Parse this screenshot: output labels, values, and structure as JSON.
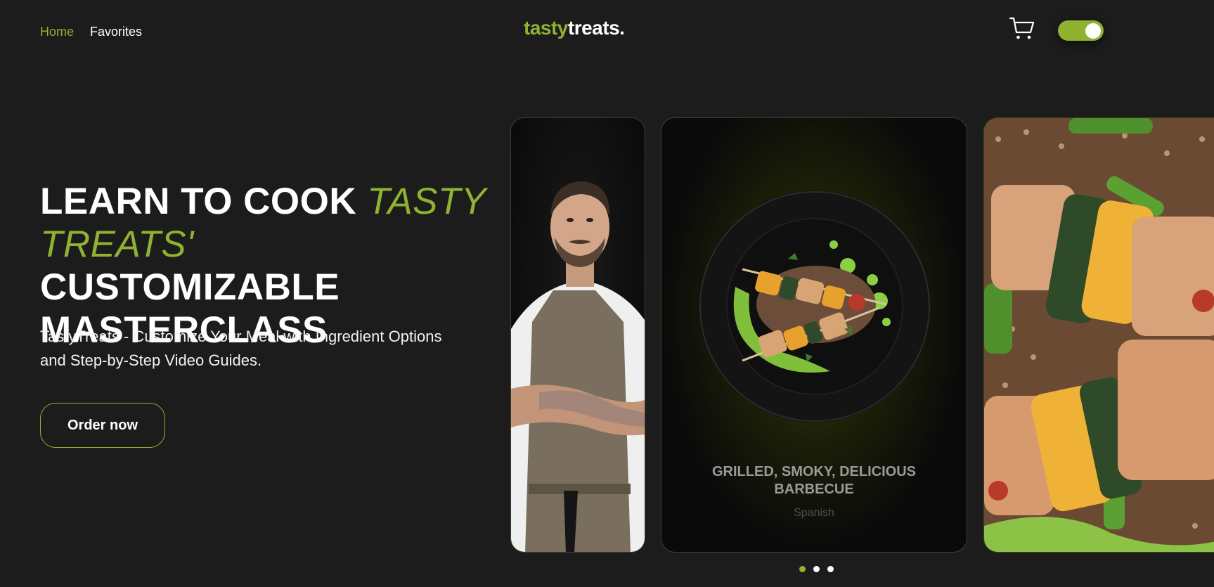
{
  "nav": {
    "items": [
      {
        "label": "Home",
        "active": true
      },
      {
        "label": "Favorites",
        "active": false
      }
    ]
  },
  "logo": {
    "part1": "tasty",
    "part2": "treats."
  },
  "header": {
    "cart_icon": "cart-icon",
    "theme_toggle": "on"
  },
  "hero": {
    "title_part1": "LEARN TO COOK ",
    "title_accent": "TASTY TREATS'",
    "title_part2": " CUSTOMIZABLE MASTERCLASS",
    "subtitle": "TastyTreats - Customize Your Meal with Ingredient Options and Step-by-Step Video Guides.",
    "cta": "Order now"
  },
  "cards": [
    {
      "image": "chef-portrait"
    },
    {
      "image": "plated-skewers",
      "title": "GRILLED, SMOKY, DELICIOUS BARBECUE",
      "subtitle": "Spanish"
    },
    {
      "image": "skewers-closeup"
    }
  ],
  "pagination": {
    "count": 3,
    "active_index": 0
  },
  "colors": {
    "accent": "#8fb331",
    "background": "#1c1c1c",
    "text": "#ffffff"
  }
}
